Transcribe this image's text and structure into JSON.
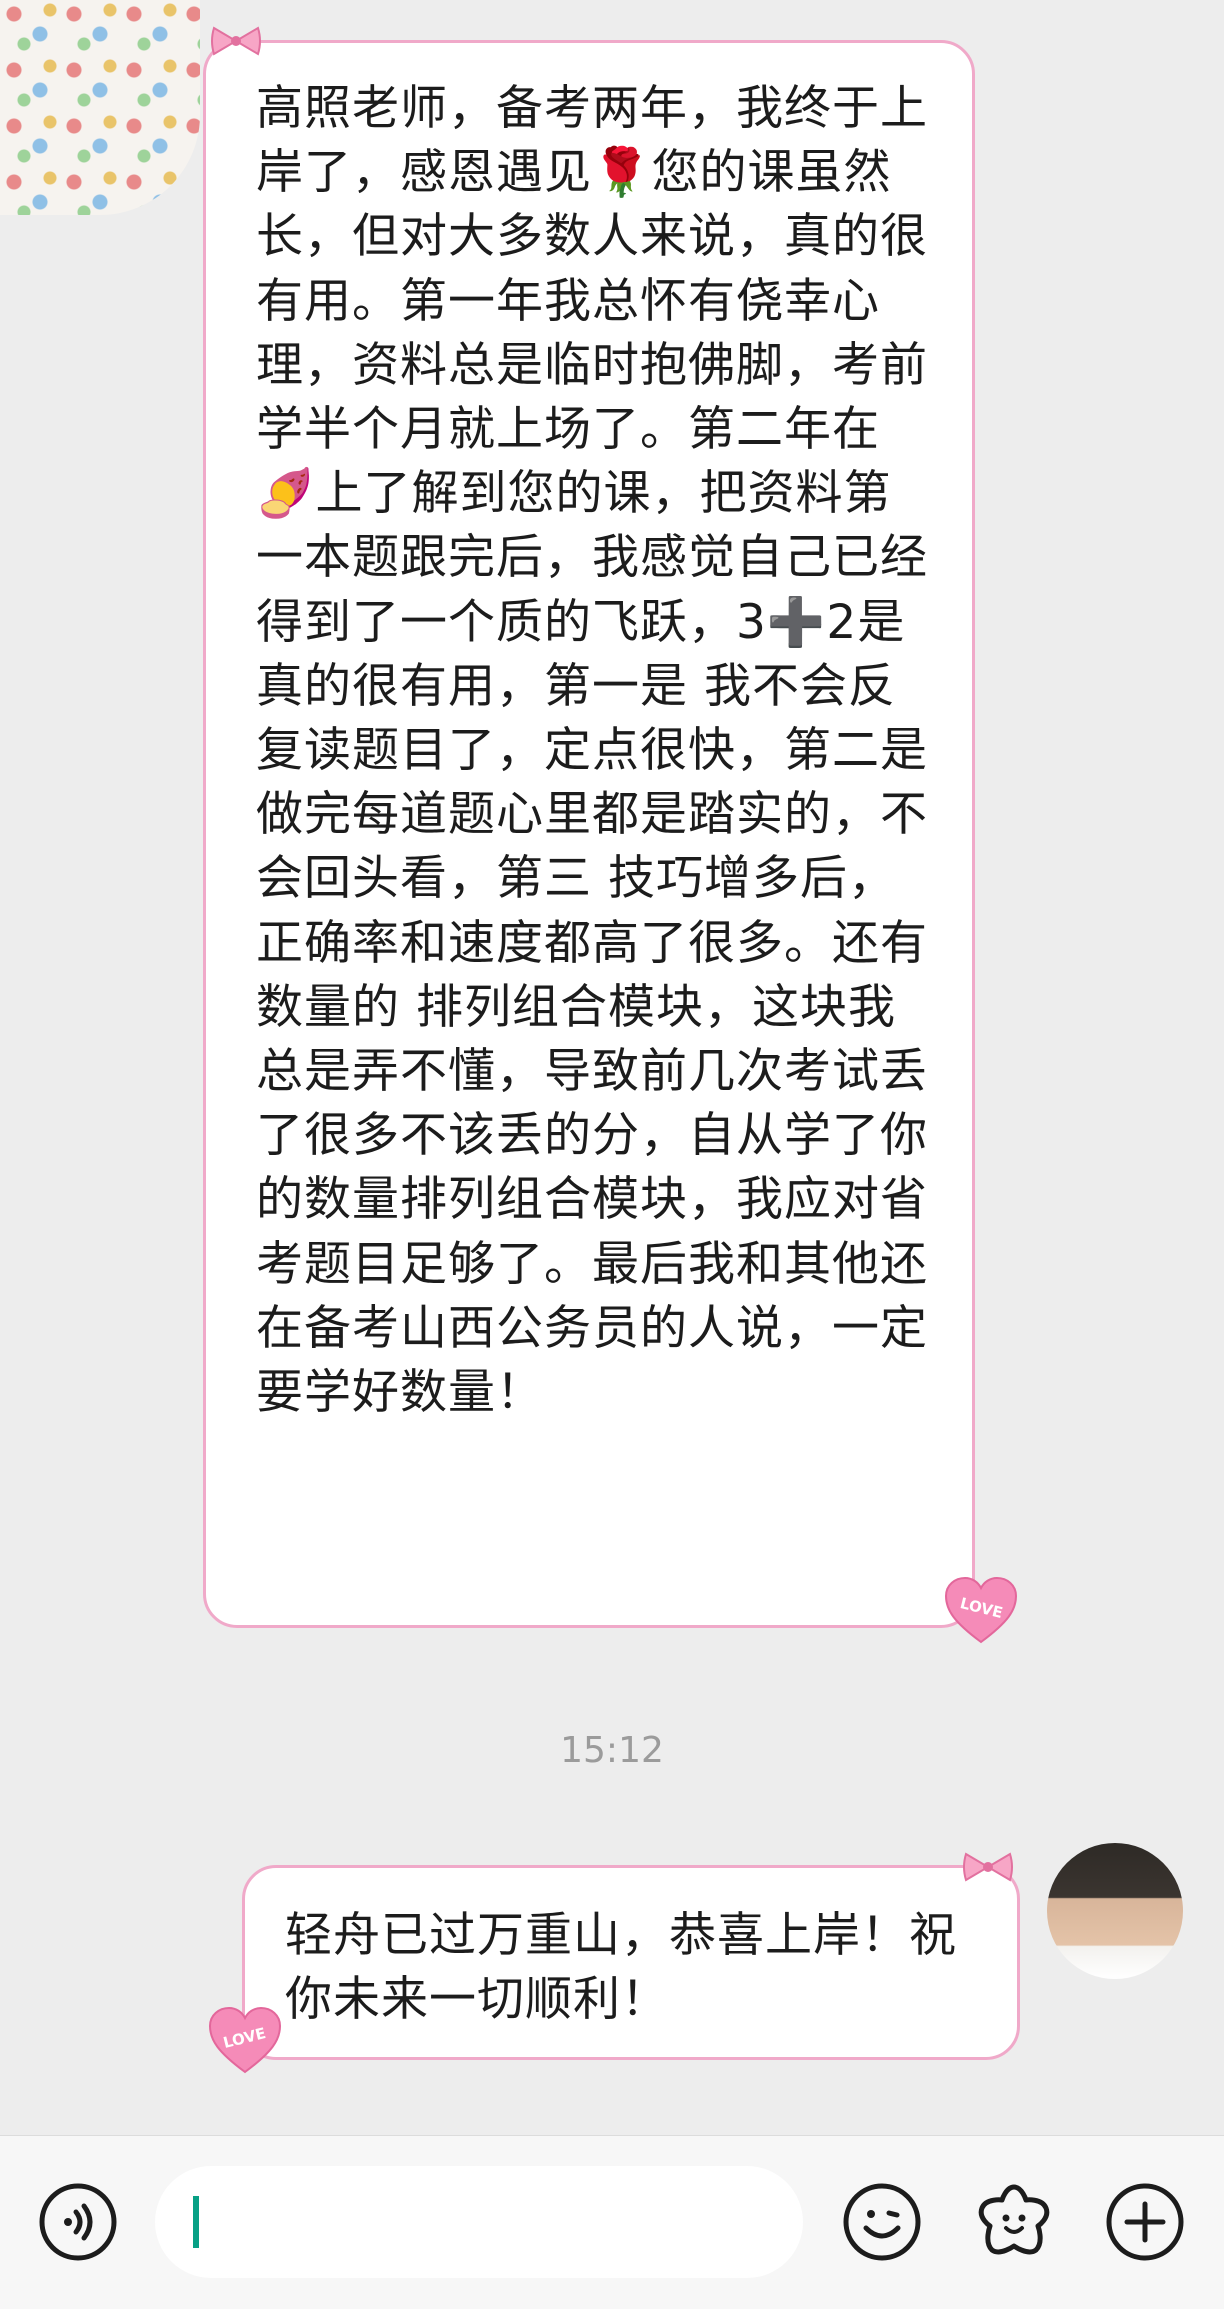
{
  "messages": [
    {
      "side": "left",
      "text": "高照老师，备考两年，我终于上岸了，感恩遇见🌹您的课虽然长，但对大多数人来说，真的很有用。第一年我总怀有侥幸心理，资料总是临时抱佛脚，考前学半个月就上场了。第二年在🍠上了解到您的课，把资料第一本题跟完后，我感觉自己已经得到了一个质的飞跃，3➕2是真的很有用，第一是 我不会反复读题目了，定点很快，第二是 做完每道题心里都是踏实的，不会回头看，第三 技巧增多后，正确率和速度都高了很多。还有数量的 排列组合模块，这块我总是弄不懂，导致前几次考试丢了很多不该丢的分，自从学了你的数量排列组合模块，我应对省考题目足够了。最后我和其他还在备考山西公务员的人说，一定要学好数量！"
    },
    {
      "side": "right",
      "text": "轻舟已过万重山，恭喜上岸！祝你未来一切顺利！"
    }
  ],
  "timestamp": "15:12",
  "decorations": {
    "heart_label": "LOVE"
  },
  "colors": {
    "bubble_border": "#f0a9c9",
    "background": "#ededed",
    "cursor": "#07a085"
  },
  "icons": {
    "voice": "voice-input-icon",
    "emoji": "emoji-icon",
    "sticker": "sticker-icon",
    "more": "plus-icon"
  }
}
